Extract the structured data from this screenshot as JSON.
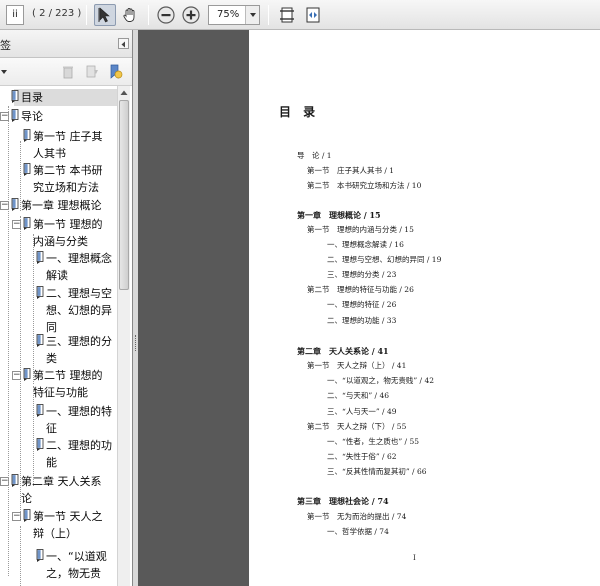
{
  "toolbar": {
    "page_input": "ii",
    "page_count": "( 2 / 223 )",
    "zoom": "75%"
  },
  "sidebar": {
    "header_label": "签",
    "tree": [
      {
        "label": "目录",
        "level": 0,
        "toggle": "",
        "selected": true
      },
      {
        "label": "导论",
        "level": 0,
        "toggle": "-"
      },
      {
        "label": "第一节 庄子其",
        "label2": "人其书",
        "level": 1
      },
      {
        "label": "第二节 本书研",
        "label2": "究立场和方法",
        "level": 1
      },
      {
        "label": "第一章 理想概论",
        "level": 0,
        "toggle": "-"
      },
      {
        "label": "第一节 理想的",
        "label2": "内涵与分类",
        "level": 1,
        "toggle": "-"
      },
      {
        "label": "一、理想概念",
        "label2": "解读",
        "level": 2
      },
      {
        "label": "二、理想与空",
        "label2": "想、幻想的异",
        "label3": "同",
        "level": 2
      },
      {
        "label": "三、理想的分",
        "label2": "类",
        "level": 2
      },
      {
        "label": "第二节 理想的",
        "label2": "特征与功能",
        "level": 1,
        "toggle": "-"
      },
      {
        "label": "一、理想的特",
        "label2": "征",
        "level": 2
      },
      {
        "label": "二、理想的功",
        "label2": "能",
        "level": 2
      },
      {
        "label": "第二章 天人关系",
        "label2": "论",
        "level": 0,
        "toggle": "-"
      },
      {
        "label": "第一节 天人之",
        "label2": "辩（上）",
        "level": 1,
        "toggle": "-"
      },
      {
        "label": "一、“以道观",
        "label2": "之，物无贵",
        "level": 2
      }
    ]
  },
  "document": {
    "title": "目 录",
    "toc": [
      {
        "text": "导　论 / 1",
        "indent": 0,
        "chapter": false
      },
      {
        "text": "第一节　庄子其人其书 / 1",
        "indent": 1,
        "chapter": false
      },
      {
        "text": "第二节　本书研究立场和方法 / 10",
        "indent": 1,
        "chapter": false
      },
      {
        "text": "第一章　理想概论 / 15",
        "indent": 0,
        "chapter": true
      },
      {
        "text": "第一节　理想的内涵与分类 / 15",
        "indent": 1,
        "chapter": false
      },
      {
        "text": "一、理想概念解读 / 16",
        "indent": 2,
        "chapter": false
      },
      {
        "text": "二、理想与空想、幻想的异同 / 19",
        "indent": 2,
        "chapter": false
      },
      {
        "text": "三、理想的分类 / 23",
        "indent": 2,
        "chapter": false
      },
      {
        "text": "第二节　理想的特征与功能 / 26",
        "indent": 1,
        "chapter": false
      },
      {
        "text": "一、理想的特征 / 26",
        "indent": 2,
        "chapter": false
      },
      {
        "text": "二、理想的功能 / 33",
        "indent": 2,
        "chapter": false
      },
      {
        "text": "第二章　天人关系论 / 41",
        "indent": 0,
        "chapter": true
      },
      {
        "text": "第一节　天人之辩（上） / 41",
        "indent": 1,
        "chapter": false
      },
      {
        "text": "一、“以道观之，物无贵贱” / 42",
        "indent": 2,
        "chapter": false
      },
      {
        "text": "二、“与天和” / 46",
        "indent": 2,
        "chapter": false
      },
      {
        "text": "三、“人与天一” / 49",
        "indent": 2,
        "chapter": false
      },
      {
        "text": "第二节　天人之辩（下） / 55",
        "indent": 1,
        "chapter": false
      },
      {
        "text": "一、“性者，生之质也” / 55",
        "indent": 2,
        "chapter": false
      },
      {
        "text": "二、“失性于俗” / 62",
        "indent": 2,
        "chapter": false
      },
      {
        "text": "三、“反其性情而复其初” / 66",
        "indent": 2,
        "chapter": false
      },
      {
        "text": "第三章　理想社会论 / 74",
        "indent": 0,
        "chapter": true
      },
      {
        "text": "第一节　无为而治的提出 / 74",
        "indent": 1,
        "chapter": false
      },
      {
        "text": "一、哲学依据 / 74",
        "indent": 2,
        "chapter": false
      }
    ],
    "page_number": "I"
  }
}
